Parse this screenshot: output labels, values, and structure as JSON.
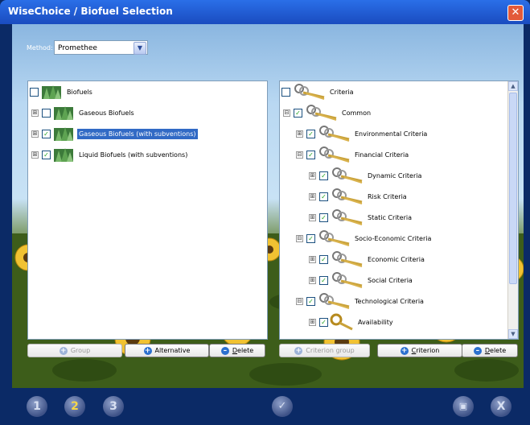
{
  "window": {
    "title": "WiseChoice / Biofuel Selection",
    "close_glyph": "✕"
  },
  "method": {
    "label": "Method:",
    "value": "Promethee",
    "arrow_icon": "chevron-down-icon"
  },
  "left_tree": [
    {
      "label": "Biofuels",
      "checked": false,
      "expander": "",
      "level": 0,
      "selected": false
    },
    {
      "label": "Gaseous Biofuels",
      "checked": false,
      "expander": "⊞",
      "level": 1,
      "selected": false
    },
    {
      "label": "Gaseous Biofuels (with subventions)",
      "checked": true,
      "expander": "⊞",
      "level": 1,
      "selected": true
    },
    {
      "label": "Liquid Biofuels (with subventions)",
      "checked": true,
      "expander": "⊞",
      "level": 1,
      "selected": false
    }
  ],
  "right_tree": [
    {
      "label": "Criteria",
      "checked": false,
      "expander": "",
      "level": 0,
      "icon": "keys"
    },
    {
      "label": "Common",
      "checked": true,
      "expander": "⊟",
      "level": 1,
      "icon": "keys"
    },
    {
      "label": "Environmental Criteria",
      "checked": true,
      "expander": "⊞",
      "level": 2,
      "icon": "keys"
    },
    {
      "label": "Financial Criteria",
      "checked": true,
      "expander": "⊟",
      "level": 2,
      "icon": "keys"
    },
    {
      "label": "Dynamic Criteria",
      "checked": true,
      "expander": "⊞",
      "level": 3,
      "icon": "keys"
    },
    {
      "label": "Risk Criteria",
      "checked": true,
      "expander": "⊞",
      "level": 3,
      "icon": "keys"
    },
    {
      "label": "Static Criteria",
      "checked": true,
      "expander": "⊞",
      "level": 3,
      "icon": "keys"
    },
    {
      "label": "Socio-Economic Criteria",
      "checked": true,
      "expander": "⊟",
      "level": 2,
      "icon": "keys"
    },
    {
      "label": "Economic Criteria",
      "checked": true,
      "expander": "⊞",
      "level": 3,
      "icon": "keys"
    },
    {
      "label": "Social Criteria",
      "checked": true,
      "expander": "⊞",
      "level": 3,
      "icon": "keys"
    },
    {
      "label": "Technological Criteria",
      "checked": true,
      "expander": "⊟",
      "level": 2,
      "icon": "keys"
    },
    {
      "label": "Availability",
      "checked": true,
      "expander": "⊞",
      "level": 3,
      "icon": "key"
    }
  ],
  "left_buttons": {
    "group": "Group",
    "alternative": "Alternative",
    "delete_prefix": "D",
    "delete_rest": "elete"
  },
  "right_buttons": {
    "criterion_group": "Criterion group",
    "criterion_prefix": "C",
    "criterion_rest": "riterion",
    "delete_prefix": "D",
    "delete_rest": "elete"
  },
  "bottom": {
    "step1": "1",
    "step2": "2",
    "step3": "3",
    "check_glyph": "✓",
    "save_glyph": "▣",
    "exit_glyph": "X"
  },
  "scroll": {
    "up": "▲",
    "down": "▼"
  },
  "colors": {
    "title_bar": "#2a6fe8",
    "selection": "#316ac5",
    "check": "#21a121"
  }
}
